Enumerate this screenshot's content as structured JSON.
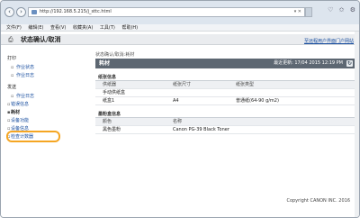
{
  "browser": {
    "url": "http://192.168.5.215/j_sttc.html",
    "url_tools": "▾ ✕",
    "win_controls": "♡ ✩ ⚙",
    "menu": [
      "文件(F)",
      "编辑(E)",
      "查看(V)",
      "收藏夹(A)",
      "工具(T)",
      "帮助(H)"
    ]
  },
  "header": {
    "title": "状态确认/取消",
    "portal_link": "至远程用户界面门户网站"
  },
  "sidebar": {
    "sections": [
      {
        "label": "打印",
        "items": [
          {
            "label": "作业状态"
          },
          {
            "label": "作业日志"
          }
        ]
      },
      {
        "label": "发送",
        "items": [
          {
            "label": "作业日志"
          }
        ]
      }
    ],
    "items": [
      {
        "label": "错误信息"
      },
      {
        "label": "耗材"
      },
      {
        "label": "设备功能"
      },
      {
        "label": "设备信息"
      },
      {
        "label": "检查计数器"
      }
    ]
  },
  "main": {
    "breadcrumb": "状态确认/取消:耗材",
    "title": "耗材",
    "updated": "最近更新: 17/04 2015 12:19 PM",
    "paper": {
      "heading": "纸张信息",
      "columns": [
        "供纸器",
        "纸张尺寸",
        "纸张类型"
      ],
      "rows": [
        [
          "手动供纸盒",
          "",
          ""
        ],
        [
          "纸盒1",
          "A4",
          "普通纸(64-90 g/m2)"
        ]
      ]
    },
    "cartridge": {
      "heading": "墨粉盒信息",
      "columns": [
        "颜色",
        "名称"
      ],
      "rows": [
        [
          "黑色墨粉",
          "Canon PG-39 Black Toner"
        ]
      ]
    }
  },
  "footer": {
    "copyright": "Copyright CANON INC. 2016"
  }
}
